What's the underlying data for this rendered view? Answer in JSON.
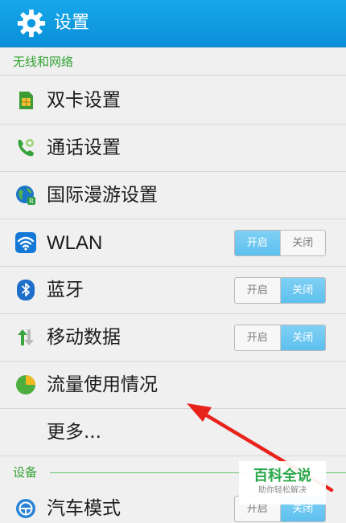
{
  "header": {
    "title": "设置",
    "icon": "gear-icon",
    "color": "#0f9be2"
  },
  "sections": {
    "network": "无线和网络",
    "device": "设备"
  },
  "rows": {
    "dual_sim": {
      "label": "双卡设置",
      "icon": "sim-card-icon"
    },
    "call": {
      "label": "通话设置",
      "icon": "phone-icon"
    },
    "roaming": {
      "label": "国际漫游设置",
      "icon": "globe-icon"
    },
    "wlan": {
      "label": "WLAN",
      "icon": "wifi-icon",
      "on": "开启",
      "off": "关闭",
      "state": "on"
    },
    "bluetooth": {
      "label": "蓝牙",
      "icon": "bluetooth-icon",
      "on": "开启",
      "off": "关闭",
      "state": "off"
    },
    "mobile_data": {
      "label": "移动数据",
      "icon": "mobile-data-icon",
      "on": "开启",
      "off": "关闭",
      "state": "off"
    },
    "data_usage": {
      "label": "流量使用情况",
      "icon": "pie-chart-icon"
    },
    "more": {
      "label": "更多..."
    },
    "car_mode": {
      "label": "汽车模式",
      "icon": "steering-wheel-icon",
      "on": "开启",
      "off": "关闭",
      "state": "off"
    }
  },
  "annotation": {
    "arrow_color": "#e8231c"
  },
  "watermark": {
    "title": "百科全说",
    "subtitle": "助你轻松解决"
  }
}
